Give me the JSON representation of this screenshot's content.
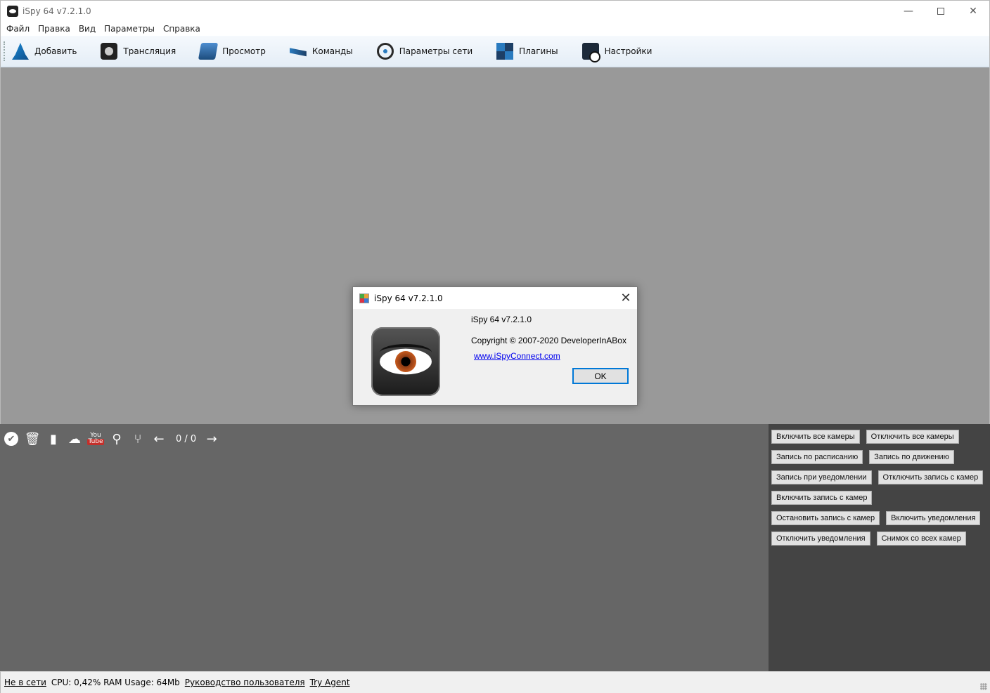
{
  "window": {
    "title": "iSpy 64 v7.2.1.0",
    "min_glyph": "—",
    "close_glyph": "✕"
  },
  "menu": {
    "items": [
      "Файл",
      "Правка",
      "Вид",
      "Параметры",
      "Справка"
    ]
  },
  "toolbar": {
    "items": [
      {
        "label": "Добавить",
        "icon": "add-icon"
      },
      {
        "label": "Трансляция",
        "icon": "broadcast-icon"
      },
      {
        "label": "Просмотр",
        "icon": "view-icon"
      },
      {
        "label": "Команды",
        "icon": "commands-icon"
      },
      {
        "label": "Параметры сети",
        "icon": "network-icon"
      },
      {
        "label": "Плагины",
        "icon": "plugins-icon"
      },
      {
        "label": "Настройки",
        "icon": "settings-icon"
      }
    ]
  },
  "media_toolbar": {
    "counter": "0 / 0",
    "check_glyph": "✔",
    "trash_glyph": "🗑",
    "bookmark_glyph": "▮",
    "upload_glyph": "☁",
    "youtube_top": "You",
    "youtube_bottom": "Tube",
    "search_glyph": "⚲",
    "share_glyph": "⑂",
    "prev_glyph": "←",
    "next_glyph": "→"
  },
  "command_buttons": [
    [
      "Включить все камеры",
      "Отключить все камеры"
    ],
    [
      "Запись по расписанию",
      "Запись по движению"
    ],
    [
      "Запись при уведомлении",
      "Отключить запись с камер"
    ],
    [
      "Включить запись с камер"
    ],
    [
      "Остановить запись с камер",
      "Включить  уведомления"
    ],
    [
      "Отключить уведомления",
      "Снимок со всех камер"
    ]
  ],
  "status": {
    "offline_link": "Не в сети",
    "usage": "CPU: 0,42% RAM Usage: 64Mb",
    "manual_link": "Руководство пользователя",
    "agent_link": "Try Agent"
  },
  "about_dialog": {
    "title": "iSpy 64 v7.2.1.0",
    "close_glyph": "✕",
    "version": "iSpy 64 v7.2.1.0",
    "copyright": "Copyright © 2007-2020 DeveloperInABox",
    "website": "www.iSpyConnect.com",
    "ok_label": "OK"
  },
  "colors": {
    "main_area": "#999999",
    "bottom_left": "#666666",
    "bottom_right": "#444444",
    "dialog_accent": "#0078d7",
    "link": "#0000ee"
  }
}
